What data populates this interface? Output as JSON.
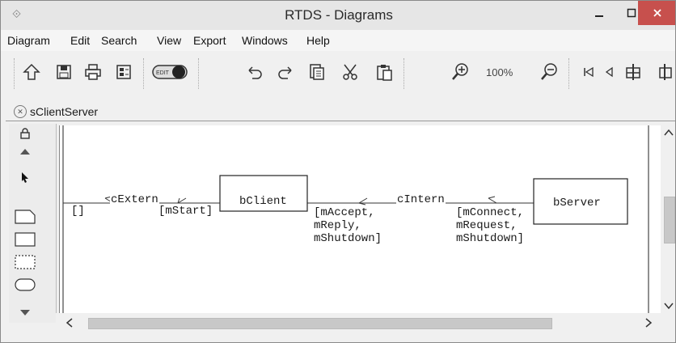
{
  "window": {
    "title": "RTDS - Diagrams"
  },
  "menu": [
    "Diagram",
    "Edit",
    "Search",
    "View",
    "Export",
    "Windows",
    "Help"
  ],
  "toolbar": {
    "zoom": "100%"
  },
  "tab": {
    "label": "sClientServer"
  },
  "diagram": {
    "left_bracket": "[]",
    "c_extern": "cExtern",
    "m_start": "[mStart]",
    "b_client": "bClient",
    "c_intern": "cIntern",
    "client_in_line1": "[mAccept,",
    "client_in_line2": "mReply,",
    "client_in_line3": "mShutdown]",
    "server_in_line1": "[mConnect,",
    "server_in_line2": "mRequest,",
    "server_in_line3": "mShutdown]",
    "b_server": "bServer"
  }
}
